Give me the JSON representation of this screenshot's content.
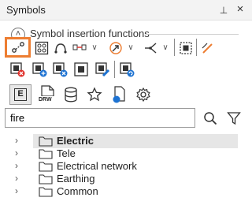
{
  "panel": {
    "title": "Symbols"
  },
  "group": {
    "title": "Symbol insertion functions",
    "collapse_glyph": "˄"
  },
  "search": {
    "value": "fire"
  },
  "tree": {
    "items": [
      {
        "label": "Electric",
        "selected": true
      },
      {
        "label": "Tele"
      },
      {
        "label": "Electrical network"
      },
      {
        "label": "Earthing"
      },
      {
        "label": "Common"
      }
    ]
  },
  "tabs": [
    "E",
    "DRW"
  ],
  "colors": {
    "highlight": "#ed7d31",
    "selection": "#e6e6e6",
    "accent_red": "#e0312b",
    "accent_blue": "#1e73d2"
  }
}
